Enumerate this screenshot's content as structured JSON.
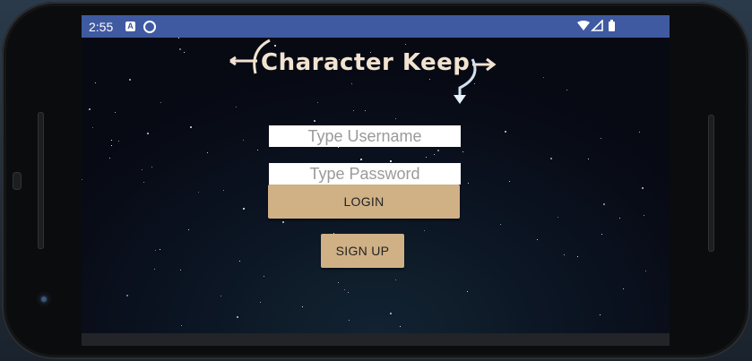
{
  "status_bar": {
    "time": "2:55",
    "notification_icons": [
      "a-icon",
      "sync-icon"
    ],
    "system_icons": [
      "wifi-icon",
      "signal-icon",
      "battery-icon"
    ]
  },
  "app": {
    "title": "Character Keep",
    "username": {
      "placeholder": "Type Username",
      "value": ""
    },
    "password": {
      "placeholder": "Type Password",
      "value": ""
    },
    "login_label": "LOGIN",
    "signup_label": "SIGN UP"
  },
  "colors": {
    "status_bar": "#3f5aa1",
    "button": "#d0b186",
    "logo_text": "#f1e3d0",
    "background": "#070a13"
  }
}
